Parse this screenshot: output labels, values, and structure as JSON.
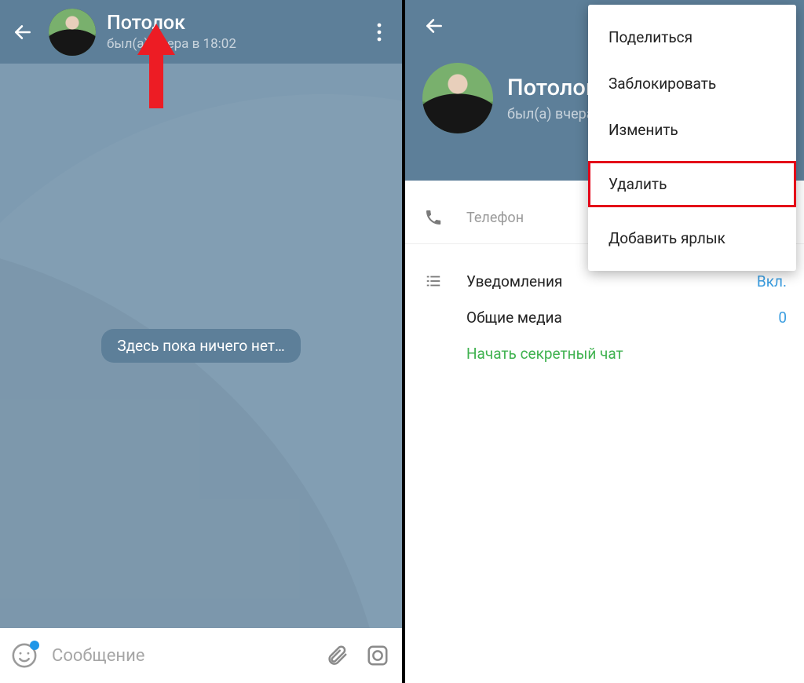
{
  "leftPanel": {
    "contactName": "Потолок",
    "lastSeen": "был(а) вчера в 18:02",
    "emptyMessage": "Здесь пока ничего нет…",
    "composePlaceholder": "Сообщение"
  },
  "rightPanel": {
    "contactName": "Потолок",
    "lastSeenPartial": "был(а) вчера",
    "phoneLabel": "Телефон",
    "notificationsLabel": "Уведомления",
    "notificationsValue": "Вкл.",
    "sharedMediaLabel": "Общие медиа",
    "sharedMediaValue": "0",
    "secretChat": "Начать секретный чат",
    "menu": {
      "share": "Поделиться",
      "block": "Заблокировать",
      "edit": "Изменить",
      "delete": "Удалить",
      "addShortcut": "Добавить ярлык"
    }
  }
}
